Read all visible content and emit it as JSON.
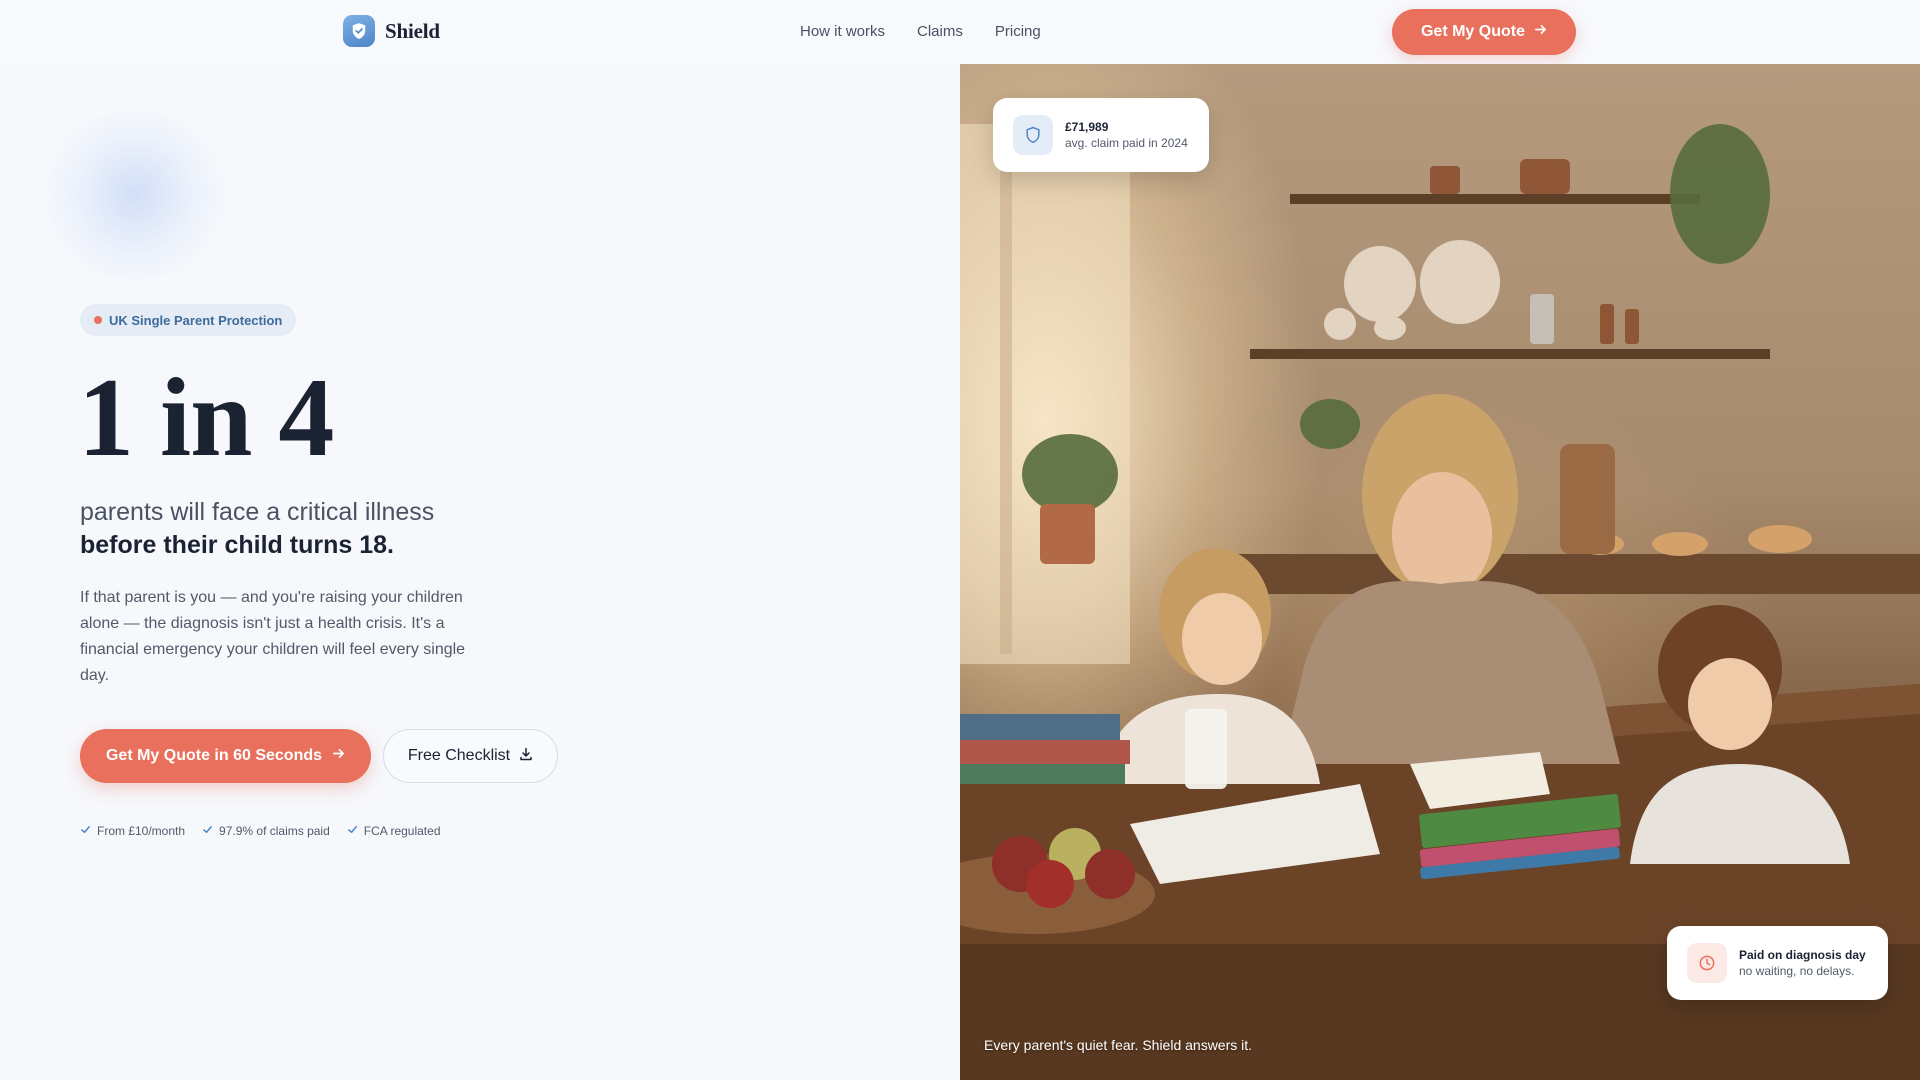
{
  "brand": {
    "name": "Shield"
  },
  "nav": {
    "items": [
      "How it works",
      "Claims",
      "Pricing"
    ],
    "cta_label": "Get My Quote"
  },
  "hero": {
    "badge": "UK Single Parent Protection",
    "stat": "1 in 4",
    "subtitle_line1": "parents will face a critical illness",
    "subtitle_line2": "before their child turns 18.",
    "body": "If that parent is you — and you're raising your children alone — the diagnosis isn't just a health crisis. It's a financial emergency your children will feel every single day.",
    "primary_cta": "Get My Quote in 60 Seconds",
    "secondary_cta": "Free Checklist",
    "trust": [
      "From £10/month",
      "97.9% of claims paid",
      "FCA regulated"
    ]
  },
  "photo": {
    "stat_card": {
      "amount": "£71,989",
      "label": "avg. claim paid in 2024"
    },
    "diag_card": {
      "title": "Paid on diagnosis day",
      "subtitle": "no waiting, no delays."
    },
    "caption": "Every parent's quiet fear. Shield answers it."
  },
  "icons": {
    "logo": "shield-check-icon",
    "header_cta": "arrow-right-icon",
    "primary_cta": "arrow-right-icon",
    "secondary_cta": "download-icon",
    "trust": "check-icon",
    "stat_card": "shield-icon",
    "diag_card": "clock-icon"
  },
  "colors": {
    "accent": "#e8705d",
    "brand_blue": "#4d86c9",
    "text_dark": "#1b2333",
    "page_bg": "#f6f8fc"
  }
}
